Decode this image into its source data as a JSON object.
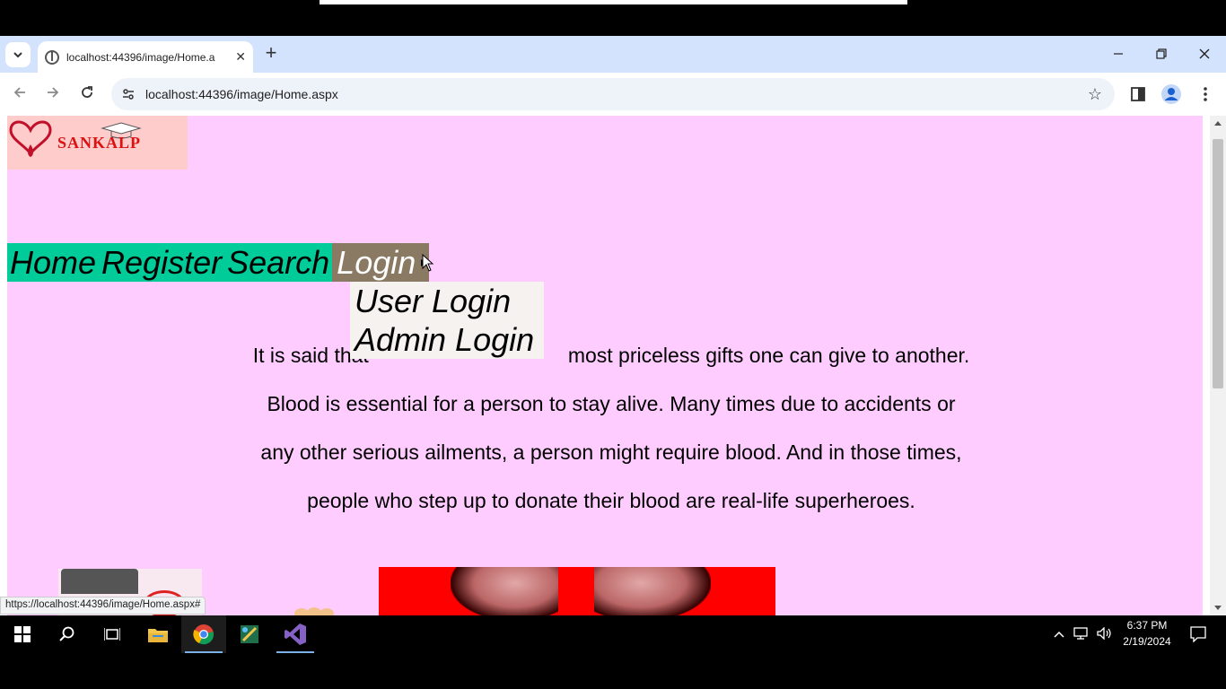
{
  "browser": {
    "tab_title": "localhost:44396/image/Home.a",
    "url": "localhost:44396/image/Home.aspx",
    "status_url": "https://localhost:44396/image/Home.aspx#"
  },
  "page": {
    "logo_text": "SANKALP",
    "menu": {
      "home": "Home",
      "register": "Register",
      "search": "Search",
      "login": "Login",
      "dropdown": [
        "User Login",
        "Admin Login"
      ]
    },
    "paragraph_lines": [
      "It is said that blood is one of the most priceless gifts one can give to another.",
      "Blood is essential for a person to stay alive. Many times due to accidents or",
      "any other serious ailments, a person might require blood. And in those times,",
      "people who step up to donate their blood are real-life superheroes."
    ],
    "paragraph_line1_visible_left": "It is said that",
    "paragraph_line1_visible_right": "most priceless gifts one can give to another."
  },
  "taskbar": {
    "time": "6:37 PM",
    "date": "2/19/2024"
  },
  "colors": {
    "page_bg": "#ffccff",
    "menu_bg": "#00cc99",
    "login_bg": "#8b7a63",
    "dropdown_bg": "#f5f2f0"
  }
}
